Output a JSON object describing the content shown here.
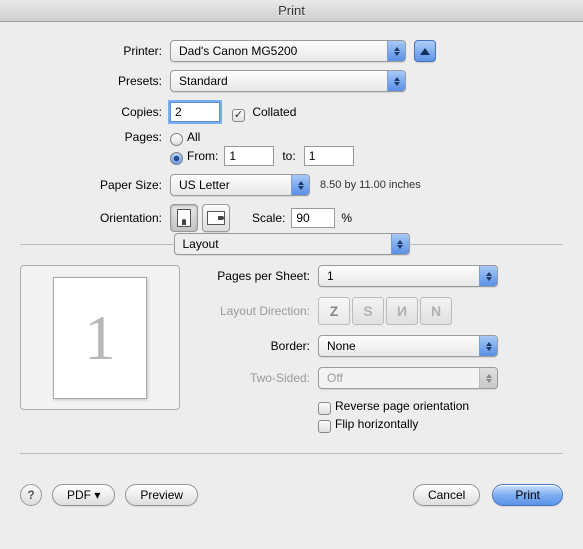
{
  "title": "Print",
  "labels": {
    "printer": "Printer:",
    "presets": "Presets:",
    "copies": "Copies:",
    "collated": "Collated",
    "pages": "Pages:",
    "all": "All",
    "from": "From:",
    "to": "to:",
    "paperSize": "Paper Size:",
    "paperDim": "8.50 by 11.00 inches",
    "orientation": "Orientation:",
    "scale": "Scale:",
    "percent": "%",
    "section": "Layout",
    "pps": "Pages per Sheet:",
    "layoutDir": "Layout Direction:",
    "border": "Border:",
    "twoSided": "Two-Sided:",
    "reverse": "Reverse page orientation",
    "flip": "Flip horizontally"
  },
  "values": {
    "printer": "Dad's Canon MG5200",
    "presets": "Standard",
    "copies": "2",
    "collated": true,
    "pagesMode": "range",
    "from": "1",
    "to": "1",
    "paperSize": "US Letter",
    "scale": "90",
    "pps": "1",
    "border": "None",
    "twoSided": "Off",
    "reverse": false,
    "flip": false,
    "previewPage": "1"
  },
  "footer": {
    "pdf": "PDF ▾",
    "preview": "Preview",
    "cancel": "Cancel",
    "print": "Print"
  }
}
